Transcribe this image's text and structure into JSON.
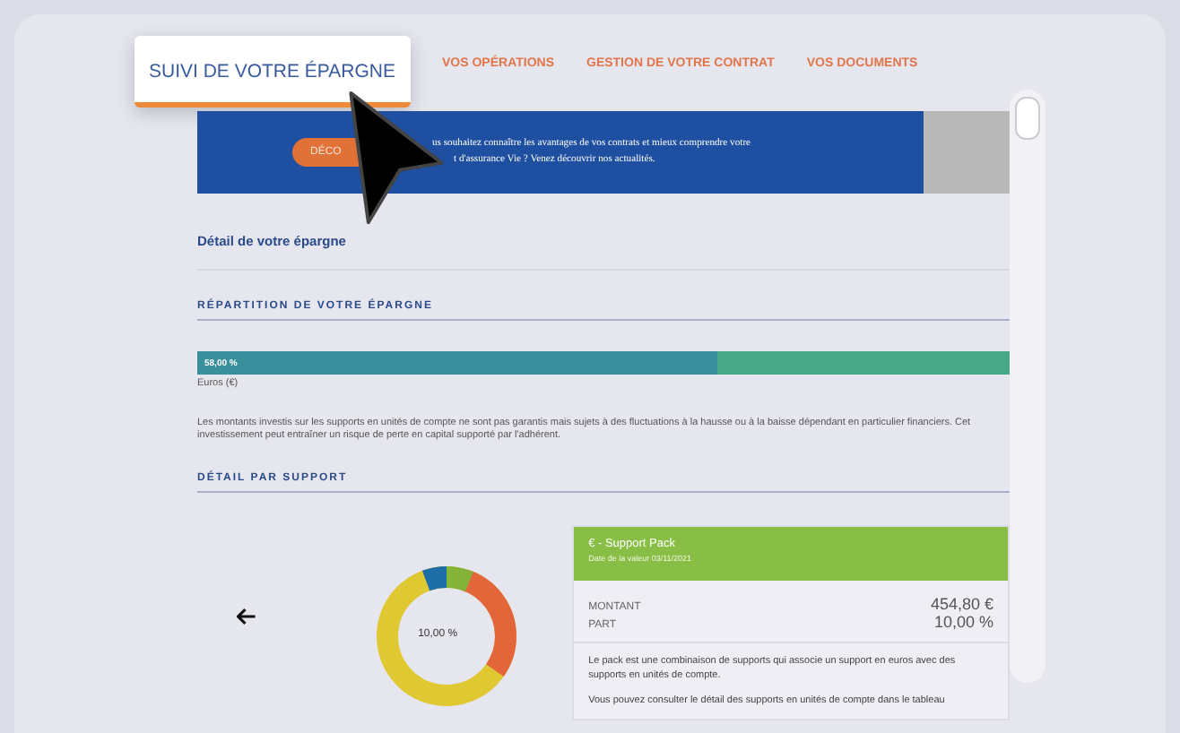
{
  "tabs": [
    {
      "label": "SUIVI DE VOTRE ÉPARGNE",
      "selected": true
    },
    {
      "label": "VOS OPÉRATIONS",
      "selected": false
    },
    {
      "label": "GESTION DE VOTRE CONTRAT",
      "selected": false
    },
    {
      "label": "VOS DOCUMENTS",
      "selected": false
    }
  ],
  "banner": {
    "button": "DÉCO",
    "lines": [
      "us souhaitez connaître les avantages de vos contrats et mieux comprendre votre",
      "t d'assurance Vie ? Venez découvrir nos actualités."
    ]
  },
  "detail_title": "Détail de votre épargne",
  "repartition": {
    "heading": "RÉPARTITION DE VOTRE ÉPARGNE",
    "bar_label": "58,00 %",
    "level": 0.64,
    "legend": "Euros (€)",
    "disclaimer": "Les montants investis sur les supports en unités de compte ne sont pas garantis mais sujets à des fluctuations à la hausse ou à la baisse dépendant en particulier financiers. Cet investissement peut entraîner un risque de perte en capital supporté par l'adhérent."
  },
  "support": {
    "heading": "DÉTAIL PAR SUPPORT",
    "donut_center": "10,00 %",
    "card": {
      "title": "€ - Support Pack",
      "date": "Date de la valeur 03/11/2021",
      "rows": [
        {
          "label": "MONTANT",
          "value": "454,80 €"
        },
        {
          "label": "PART",
          "value": "10,00 %"
        }
      ],
      "paragraphs": [
        "Le pack est une combinaison de supports qui associe un support en euros avec des supports en unités de compte.",
        "Vous pouvez consulter le détail des supports en unités de compte dans le tableau"
      ]
    }
  }
}
